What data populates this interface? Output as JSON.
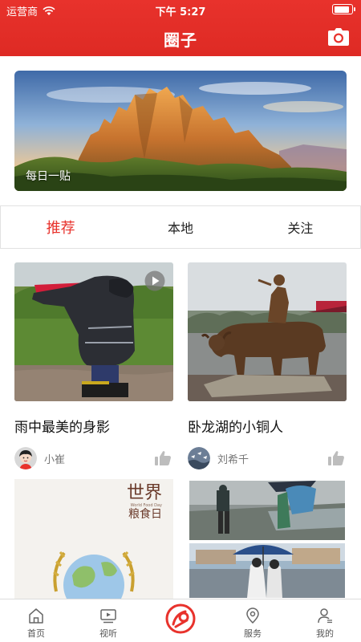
{
  "status_bar": {
    "carrier": "运营商",
    "time": "下午 5:27",
    "battery_level": 0.9
  },
  "header": {
    "title": "圈子"
  },
  "banner": {
    "label": "每日一贴"
  },
  "tabs": [
    {
      "label": "推荐",
      "active": true
    },
    {
      "label": "本地",
      "active": false
    },
    {
      "label": "关注",
      "active": false
    }
  ],
  "posts": [
    {
      "title": "雨中最美的身影",
      "author": "小崔",
      "has_video": true
    },
    {
      "title": "卧龙湖的小铜人",
      "author": "刘希千",
      "has_video": false
    }
  ],
  "more_posts": [
    {
      "poster_title": "世界",
      "poster_subtitle": "粮食日",
      "poster_caption": "World Food Day"
    },
    {
      "image_only": true
    }
  ],
  "bottom_nav": [
    {
      "label": "首页",
      "icon": "home-icon"
    },
    {
      "label": "视听",
      "icon": "tv-icon"
    },
    {
      "label": "",
      "icon": "center-logo-icon"
    },
    {
      "label": "服务",
      "icon": "location-pin-icon"
    },
    {
      "label": "我的",
      "icon": "user-icon"
    }
  ],
  "colors": {
    "brand": "#e8322c",
    "active_tab": "#e8322c",
    "text": "#222222",
    "muted": "#777777"
  }
}
